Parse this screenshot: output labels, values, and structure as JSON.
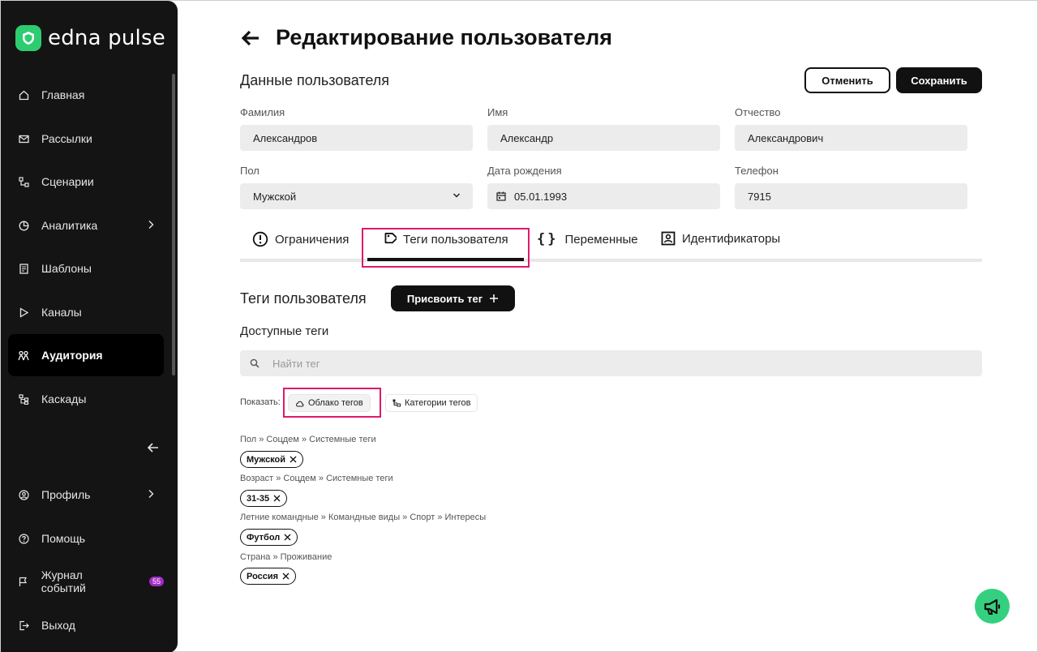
{
  "app": {
    "logo_text": "edna pulse"
  },
  "sidebar": {
    "items": [
      {
        "label": "Главная"
      },
      {
        "label": "Рассылки"
      },
      {
        "label": "Сценарии"
      },
      {
        "label": "Аналитика"
      },
      {
        "label": "Шаблоны"
      },
      {
        "label": "Каналы"
      },
      {
        "label": "Аудитория",
        "active": true
      },
      {
        "label": "Каскады"
      }
    ],
    "bottom": [
      {
        "label": "Профиль"
      },
      {
        "label": "Помощь"
      },
      {
        "label": "Журнал событий",
        "badge": "55"
      },
      {
        "label": "Выход"
      }
    ]
  },
  "page": {
    "title": "Редактирование пользователя",
    "section_title": "Данные пользователя",
    "cancel_label": "Отменить",
    "save_label": "Сохранить"
  },
  "form": {
    "last_name": {
      "label": "Фамилия",
      "value": "Александров"
    },
    "first_name": {
      "label": "Имя",
      "value": "Александр"
    },
    "middle_name": {
      "label": "Отчество",
      "value": "Александрович"
    },
    "gender": {
      "label": "Пол",
      "value": "Мужской"
    },
    "birth_date": {
      "label": "Дата рождения",
      "value": "05.01.1993"
    },
    "phone": {
      "label": "Телефон",
      "value": "7915"
    }
  },
  "tabs": [
    {
      "label": "Ограничения"
    },
    {
      "label": "Теги пользователя",
      "active": true
    },
    {
      "label": "Переменные"
    },
    {
      "label": "Идентификаторы"
    }
  ],
  "tags": {
    "title": "Теги пользователя",
    "assign_label": "Присвоить тег",
    "available_label": "Доступные теги",
    "search_placeholder": "Найти тег",
    "show_label": "Показать:",
    "view_cloud": "Облако тегов",
    "view_categories": "Категории тегов",
    "groups": [
      {
        "path": "Пол » Соцдем » Системные теги",
        "tag": "Мужской"
      },
      {
        "path": "Возраст » Соцдем » Системные теги",
        "tag": "31-35"
      },
      {
        "path": "Летние командные » Командные виды » Спорт » Интересы",
        "tag": "Футбол"
      },
      {
        "path": "Страна » Проживание",
        "tag": "Россия"
      }
    ]
  },
  "colors": {
    "accent": "#35d07f",
    "highlight": "#e0186c",
    "sidebar_bg": "#141414",
    "badge": "#a32cc4"
  }
}
